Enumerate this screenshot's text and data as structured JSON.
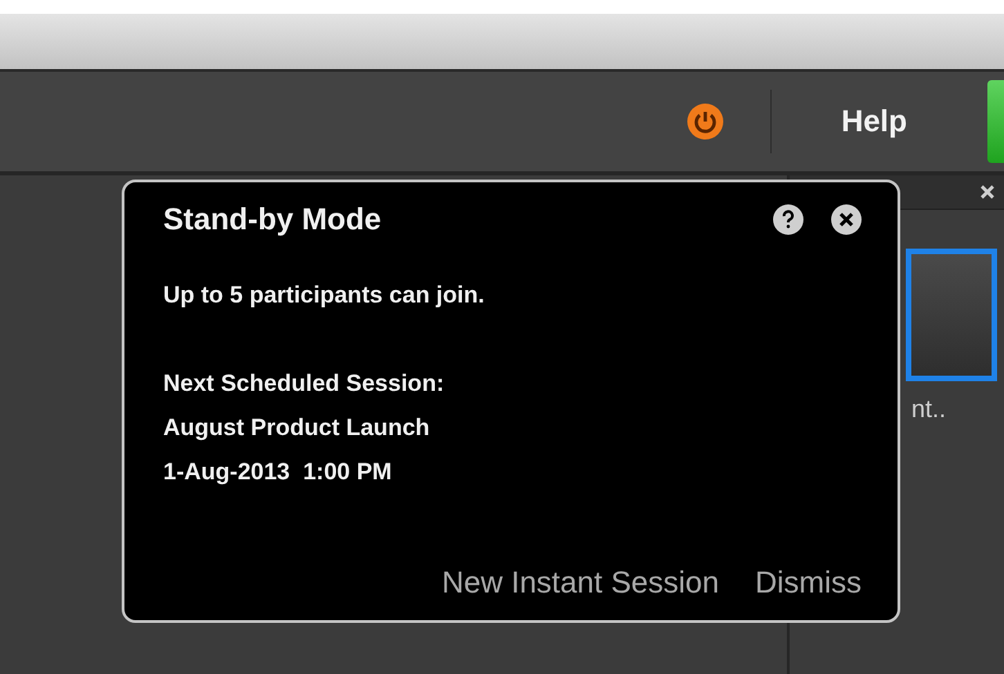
{
  "toolbar": {
    "help_label": "Help"
  },
  "right_panel": {
    "thumbnail_label": "nt.."
  },
  "dialog": {
    "title": "Stand-by Mode",
    "message": "Up to 5 participants can join.",
    "next_session_label": "Next Scheduled Session:",
    "next_session_name": "August Product Launch",
    "next_session_time": "1-Aug-2013  1:00 PM",
    "actions": [
      "New Instant Session",
      "Dismiss"
    ]
  }
}
